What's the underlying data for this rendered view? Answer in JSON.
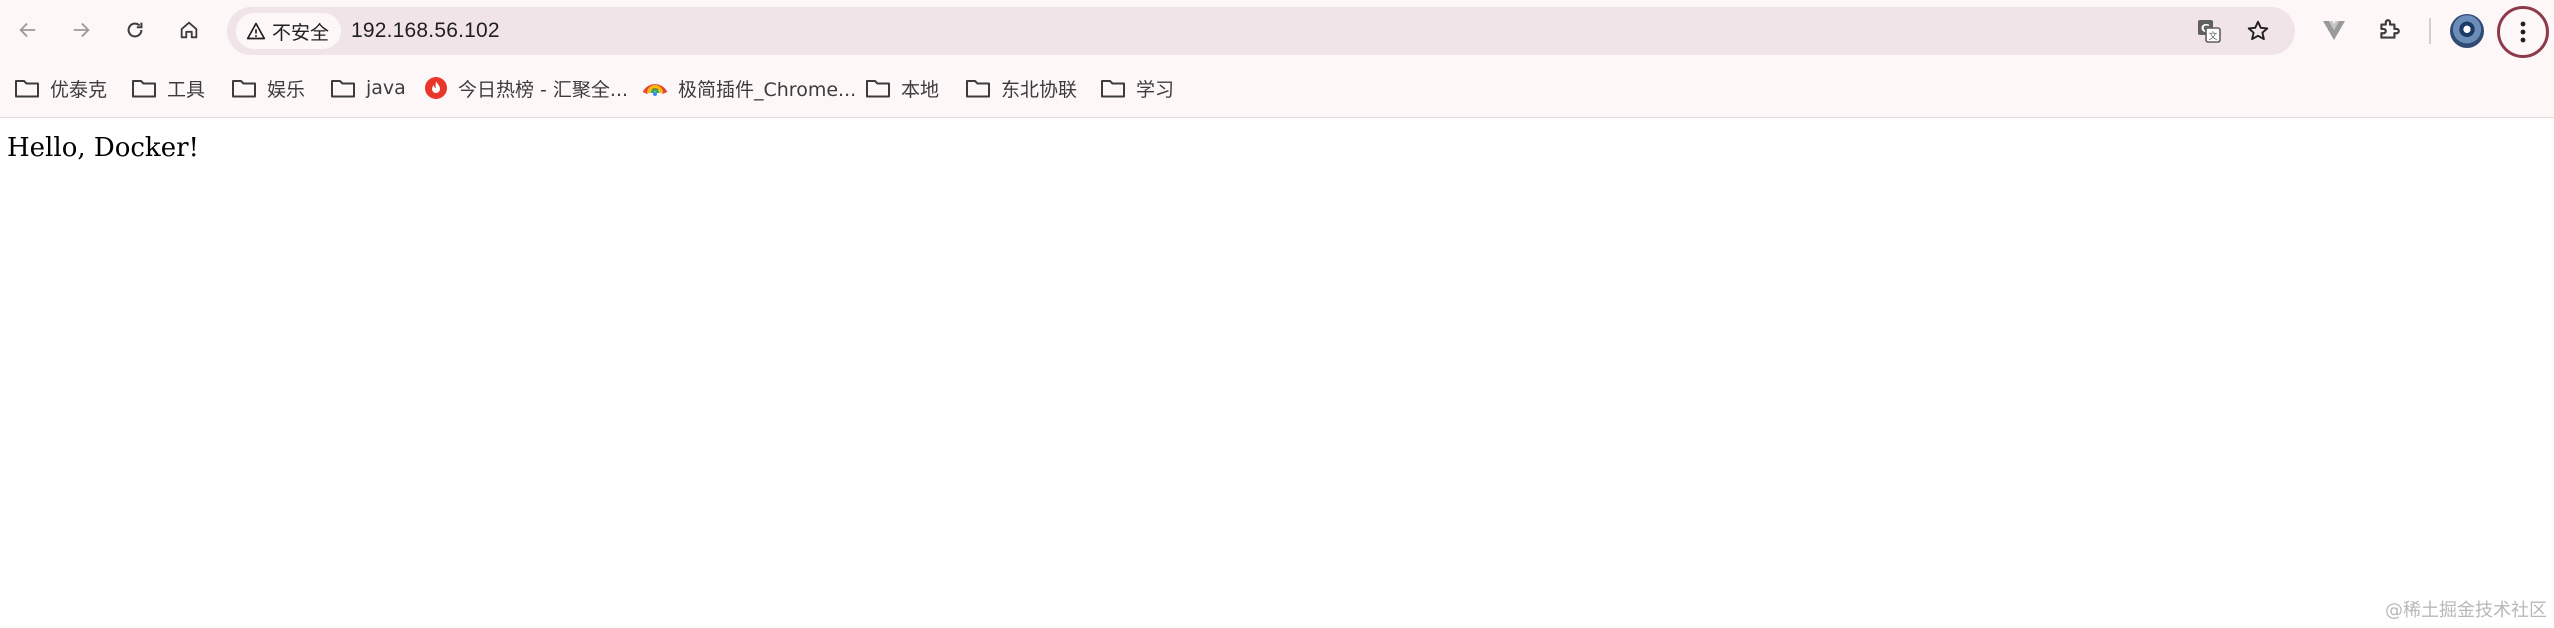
{
  "browser": {
    "nav": {
      "back_icon": "arrow-left-icon",
      "forward_icon": "arrow-right-icon",
      "reload_icon": "reload-icon",
      "home_icon": "home-icon"
    },
    "omnibox": {
      "security_label": "不安全",
      "security_icon": "warning-triangle-icon",
      "url": "192.168.56.102",
      "translate_icon": "translate-icon",
      "bookmark_star_icon": "star-icon"
    },
    "toolbar": {
      "extension_v_icon": "vue-devtools-icon",
      "extensions_icon": "puzzle-icon",
      "profile_icon": "avatar",
      "menu_icon": "kebab-menu-icon"
    },
    "colors": {
      "toolbar_bg": "#fdf7f8",
      "omnibox_bg": "#f1e4e8",
      "menu_ring": "#8d3b4a"
    }
  },
  "bookmarks": [
    {
      "label": "优泰克",
      "icon": "folder-icon"
    },
    {
      "label": "工具",
      "icon": "folder-icon"
    },
    {
      "label": "娱乐",
      "icon": "folder-icon"
    },
    {
      "label": "java",
      "icon": "folder-icon"
    },
    {
      "label": "今日热榜 - 汇聚全...",
      "icon": "flame-icon"
    },
    {
      "label": "极简插件_Chrome...",
      "icon": "chrome-icon"
    },
    {
      "label": "本地",
      "icon": "folder-icon"
    },
    {
      "label": "东北协联",
      "icon": "folder-icon"
    },
    {
      "label": "学习",
      "icon": "folder-icon"
    }
  ],
  "page": {
    "body_text": "Hello, Docker!"
  },
  "watermark": "@稀土掘金技术社区"
}
